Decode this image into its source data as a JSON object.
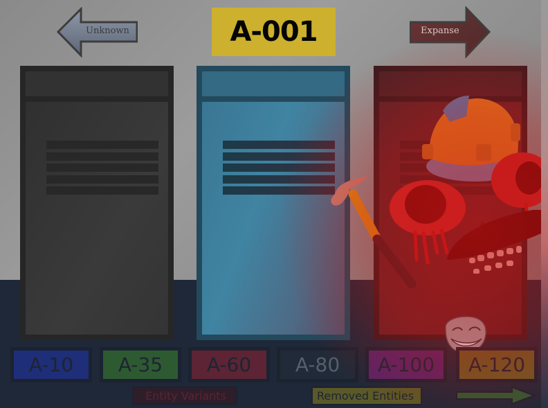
{
  "title": "A-001",
  "nav": {
    "prev_label": "Unknown",
    "next_label": "Expanse"
  },
  "doors": [
    {
      "name": "door-left",
      "color": "#262626"
    },
    {
      "name": "door-middle",
      "color": "#23495c"
    },
    {
      "name": "door-right",
      "color": "#3a1a1e"
    }
  ],
  "categories": [
    {
      "label": "A-10",
      "color": "#1e2e78"
    },
    {
      "label": "A-35",
      "color": "#2e5a32"
    },
    {
      "label": "A-60",
      "color": "#5c2434"
    },
    {
      "label": "A-80",
      "color": "#212a38"
    },
    {
      "label": "A-100",
      "color": "#5a2466"
    },
    {
      "label": "A-120",
      "color": "#6a5c24"
    }
  ],
  "bottom": {
    "variants_label": "Entity Variants",
    "removed_label": "Removed Entities"
  },
  "icons": {
    "prev": "left-arrow-icon",
    "next": "right-arrow-icon",
    "next_page": "green-arrow-icon"
  }
}
